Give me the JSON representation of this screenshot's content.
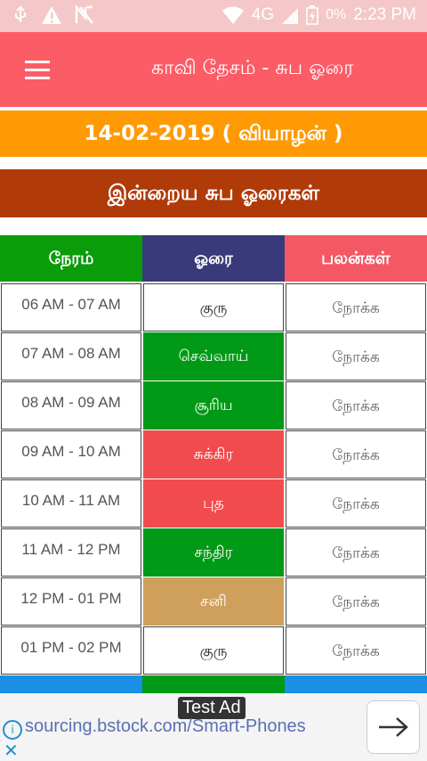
{
  "status": {
    "network": "4G",
    "battery_pct": "0%",
    "time": "2:23 PM"
  },
  "app": {
    "title": "காவி தேசம் - சுப ஓரை"
  },
  "date_line": "14-02-2019 ( வியாழன் )",
  "section_title": "இன்றைய சுப ஓரைகள்",
  "table": {
    "headers": [
      "நேரம்",
      "ஓரை",
      "பலன்கள்"
    ],
    "rows": [
      {
        "time": "06 AM - 07 AM",
        "horai": "குரு",
        "result": "நோக்க"
      },
      {
        "time": "07 AM - 08 AM",
        "horai": "செவ்வாய்",
        "result": "நோக்க"
      },
      {
        "time": "08 AM - 09 AM",
        "horai": "சூரிய",
        "result": "நோக்க"
      },
      {
        "time": "09 AM - 10 AM",
        "horai": "சுக்கிர",
        "result": "நோக்க"
      },
      {
        "time": "10 AM - 11 AM",
        "horai": "புத",
        "result": "நோக்க"
      },
      {
        "time": "11 AM - 12 PM",
        "horai": "சந்திர",
        "result": "நோக்க"
      },
      {
        "time": "12 PM - 01 PM",
        "horai": "சனி",
        "result": "நோக்க"
      },
      {
        "time": "01 PM - 02 PM",
        "horai": "குரு",
        "result": "நோக்க"
      }
    ]
  },
  "colors": {
    "white": "#ffffff",
    "green": "#009a16",
    "red": "#f24b4e",
    "tan": "#cfa05b",
    "blue_partial": "#1a8fe5",
    "pink_partial": "#f35864"
  },
  "ad": {
    "badge": "Test Ad",
    "url": "sourcing.bstock.com/Smart-Phones"
  },
  "icons": [
    "usb-icon",
    "warning-icon",
    "no-sim-icon",
    "wifi-icon",
    "signal-icon",
    "battery-icon",
    "menu-icon",
    "info-icon",
    "close-icon",
    "arrow-right-icon"
  ]
}
